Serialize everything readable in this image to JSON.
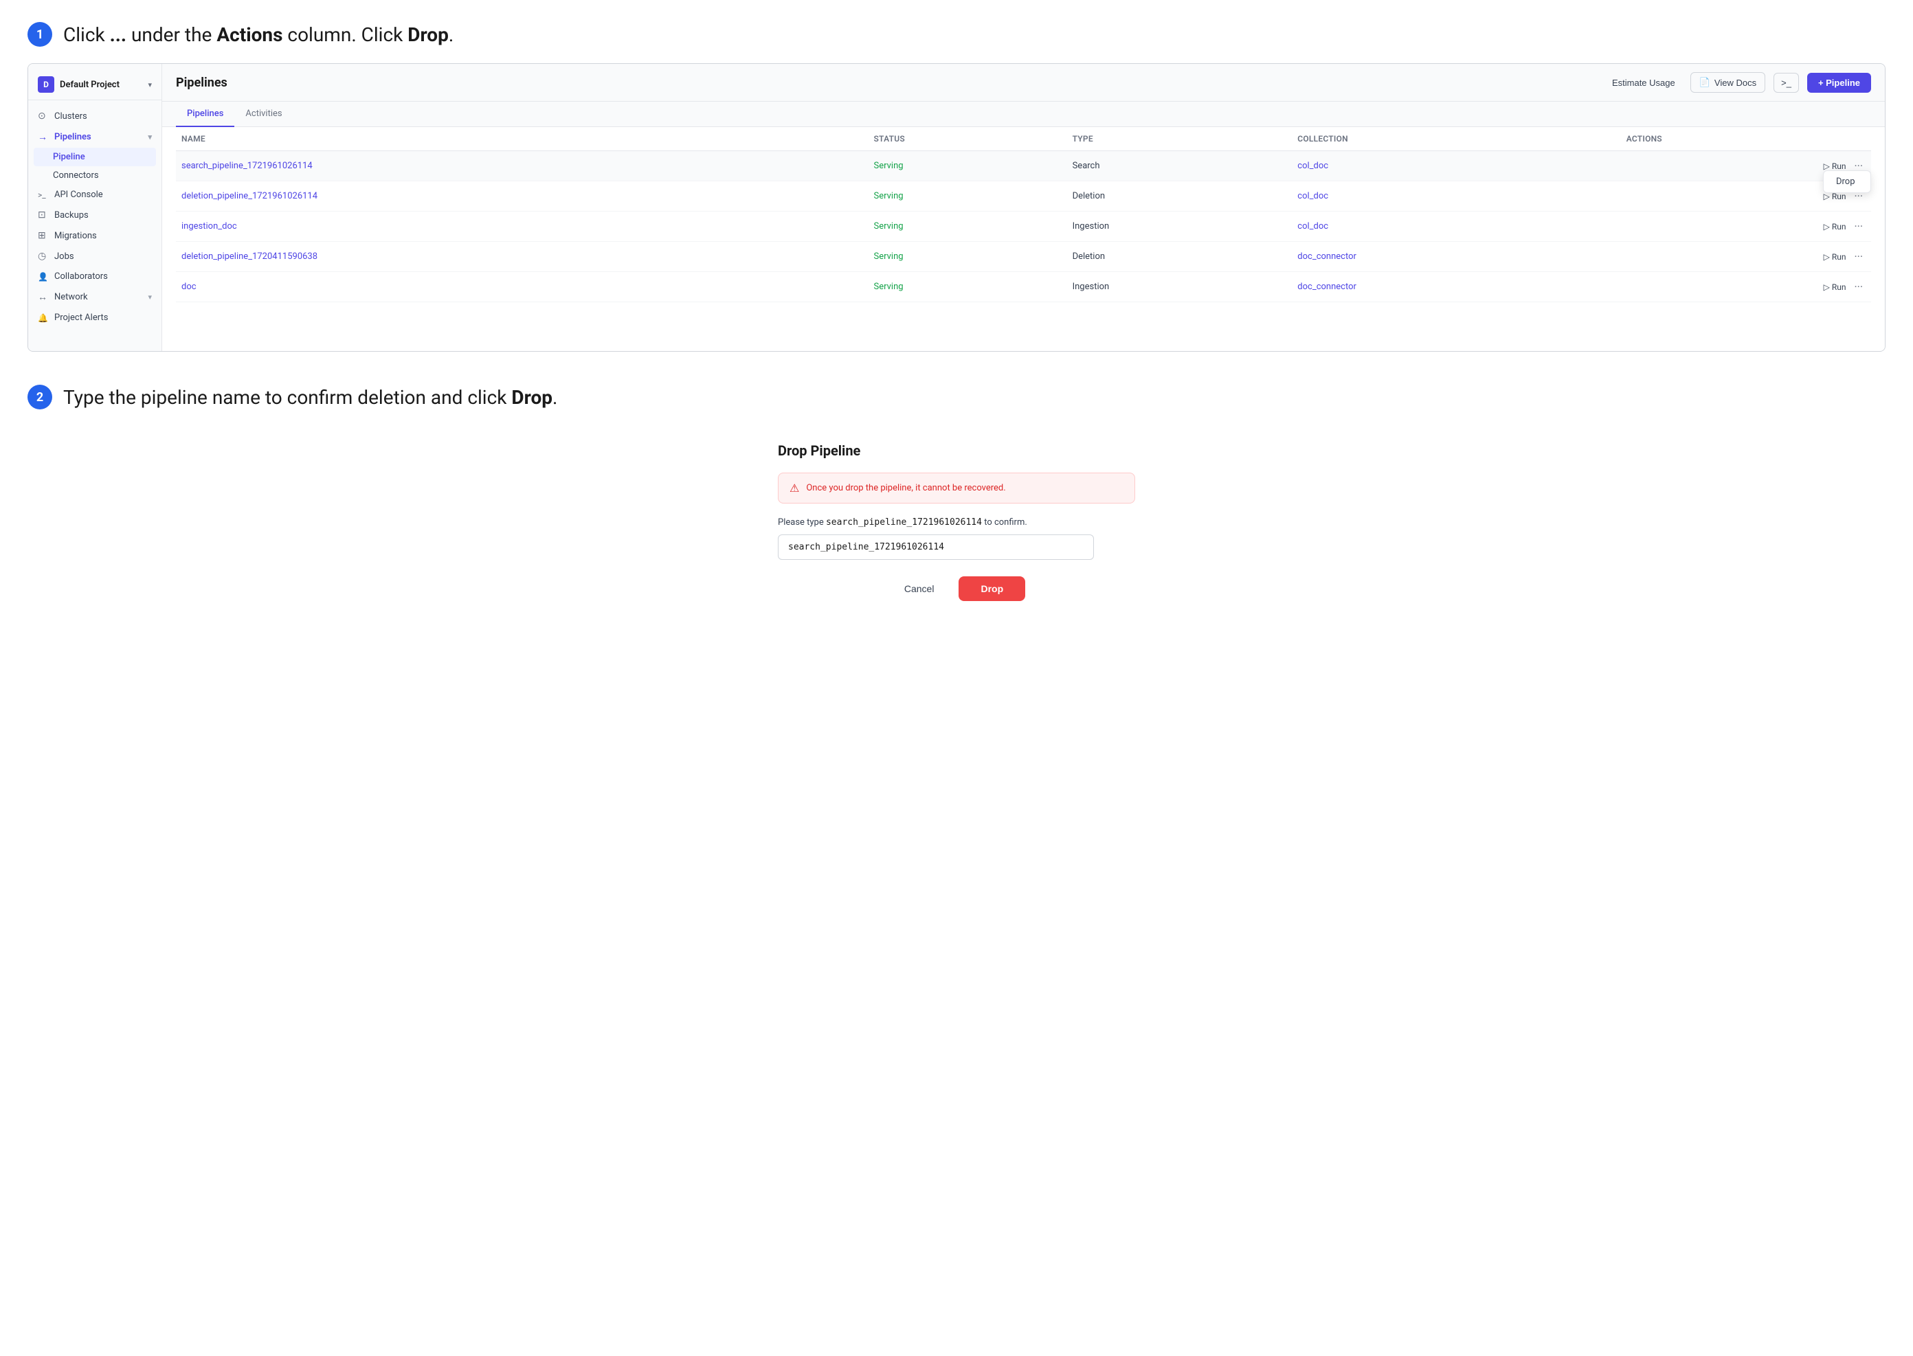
{
  "step1": {
    "number": "1",
    "text_before": "Click ",
    "dots": "...",
    "text_middle": " under the ",
    "actions_bold": "Actions",
    "text_after": " column. Click ",
    "drop_bold": "Drop",
    "period": "."
  },
  "step2": {
    "number": "2",
    "text_before": "Type the pipeline name to confirm deletion and click ",
    "drop_bold": "Drop",
    "period": "."
  },
  "sidebar": {
    "project_name": "Default Project",
    "items": [
      {
        "id": "clusters",
        "label": "Clusters",
        "icon": "○"
      },
      {
        "id": "pipelines",
        "label": "Pipelines",
        "icon": "→",
        "active": true,
        "expanded": true
      },
      {
        "id": "api-console",
        "label": "API Console",
        "icon": ">_"
      },
      {
        "id": "backups",
        "label": "Backups",
        "icon": "□"
      },
      {
        "id": "migrations",
        "label": "Migrations",
        "icon": "⊞"
      },
      {
        "id": "jobs",
        "label": "Jobs",
        "icon": "◷"
      },
      {
        "id": "collaborators",
        "label": "Collaborators",
        "icon": "👤"
      },
      {
        "id": "network",
        "label": "Network",
        "icon": "↔"
      },
      {
        "id": "project-alerts",
        "label": "Project Alerts",
        "icon": "🔔"
      }
    ],
    "sub_items": [
      {
        "id": "pipeline",
        "label": "Pipeline",
        "active": true
      },
      {
        "id": "connectors",
        "label": "Connectors"
      }
    ]
  },
  "header": {
    "title": "Pipelines",
    "estimate_label": "Estimate Usage",
    "view_docs_label": "View Docs",
    "terminal_label": ">_",
    "add_pipeline_label": "+ Pipeline"
  },
  "tabs": [
    {
      "id": "pipelines",
      "label": "Pipelines",
      "active": true
    },
    {
      "id": "activities",
      "label": "Activities"
    }
  ],
  "table": {
    "columns": [
      "Name",
      "Status",
      "Type",
      "Collection",
      "Actions"
    ],
    "rows": [
      {
        "name": "search_pipeline_1721961026114",
        "status": "Serving",
        "type": "Search",
        "collection": "col_doc",
        "highlighted": true
      },
      {
        "name": "deletion_pipeline_1721961026114",
        "status": "Serving",
        "type": "Deletion",
        "collection": "col_doc"
      },
      {
        "name": "ingestion_doc",
        "status": "Serving",
        "type": "Ingestion",
        "collection": "col_doc"
      },
      {
        "name": "deletion_pipeline_1720411590638",
        "status": "Serving",
        "type": "Deletion",
        "collection": "doc_connector"
      },
      {
        "name": "doc",
        "status": "Serving",
        "type": "Ingestion",
        "collection": "doc_connector"
      }
    ],
    "dropdown_item": "Drop"
  },
  "drop_pipeline": {
    "title": "Drop Pipeline",
    "warning_text": "Once you drop the pipeline, it cannot be recovered.",
    "confirm_prompt_before": "Please type ",
    "confirm_pipeline_name": "search_pipeline_1721961026114",
    "confirm_prompt_after": " to confirm.",
    "input_value": "search_pipeline_1721961026114",
    "cancel_label": "Cancel",
    "drop_label": "Drop"
  }
}
